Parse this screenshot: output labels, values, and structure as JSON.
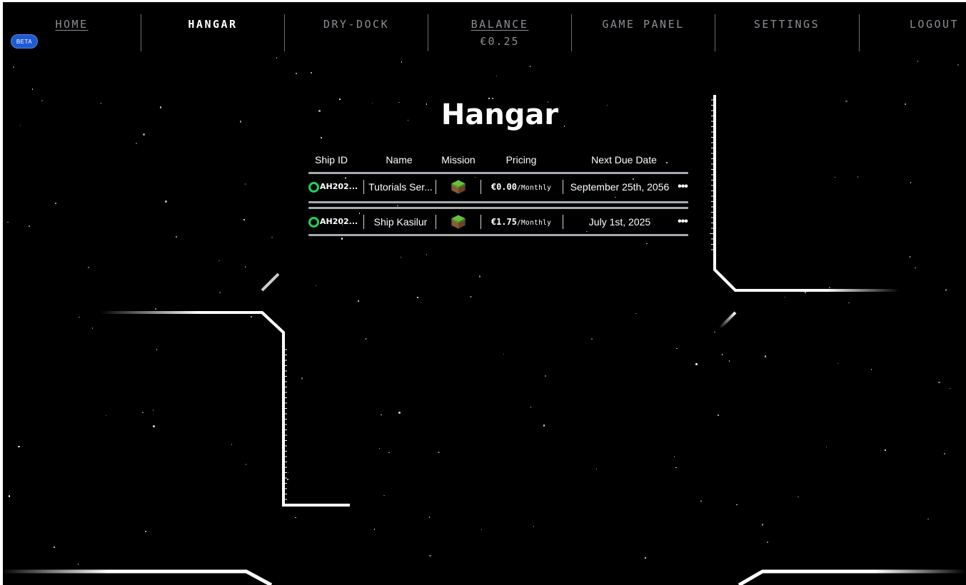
{
  "nav": {
    "home": "HOME",
    "hangar": "HANGAR",
    "drydock": "DRY-DOCK",
    "balance": "BALANCE",
    "balance_value": "€0.25",
    "gamepanel": "GAME PANEL",
    "settings": "SETTINGS",
    "logout": "LOGOUT",
    "beta": "BETA"
  },
  "page": {
    "title": "Hangar"
  },
  "table": {
    "headers": {
      "ship_id": "Ship ID",
      "name": "Name",
      "mission": "Mission",
      "pricing": "Pricing",
      "due": "Next Due Date"
    },
    "rows": [
      {
        "ship_id": "AH202...",
        "name": "Tutorials Ser...",
        "mission_icon": "minecraft-grass-block-icon",
        "price": "€0.00",
        "period": "/Monthly",
        "due": "September 25th, 2056",
        "status": "online"
      },
      {
        "ship_id": "AH202...",
        "name": "Ship Kasilur",
        "mission_icon": "minecraft-grass-block-icon",
        "price": "€1.75",
        "period": "/Monthly",
        "due": "July 1st, 2025",
        "status": "online"
      }
    ]
  },
  "colors": {
    "background": "#000000",
    "nav_text": "#8b8e94",
    "nav_active": "#ffffff",
    "status_online": "#1ed25a",
    "accent_blue": "#1e8fd0",
    "beta_badge": "#1f5ad1"
  }
}
